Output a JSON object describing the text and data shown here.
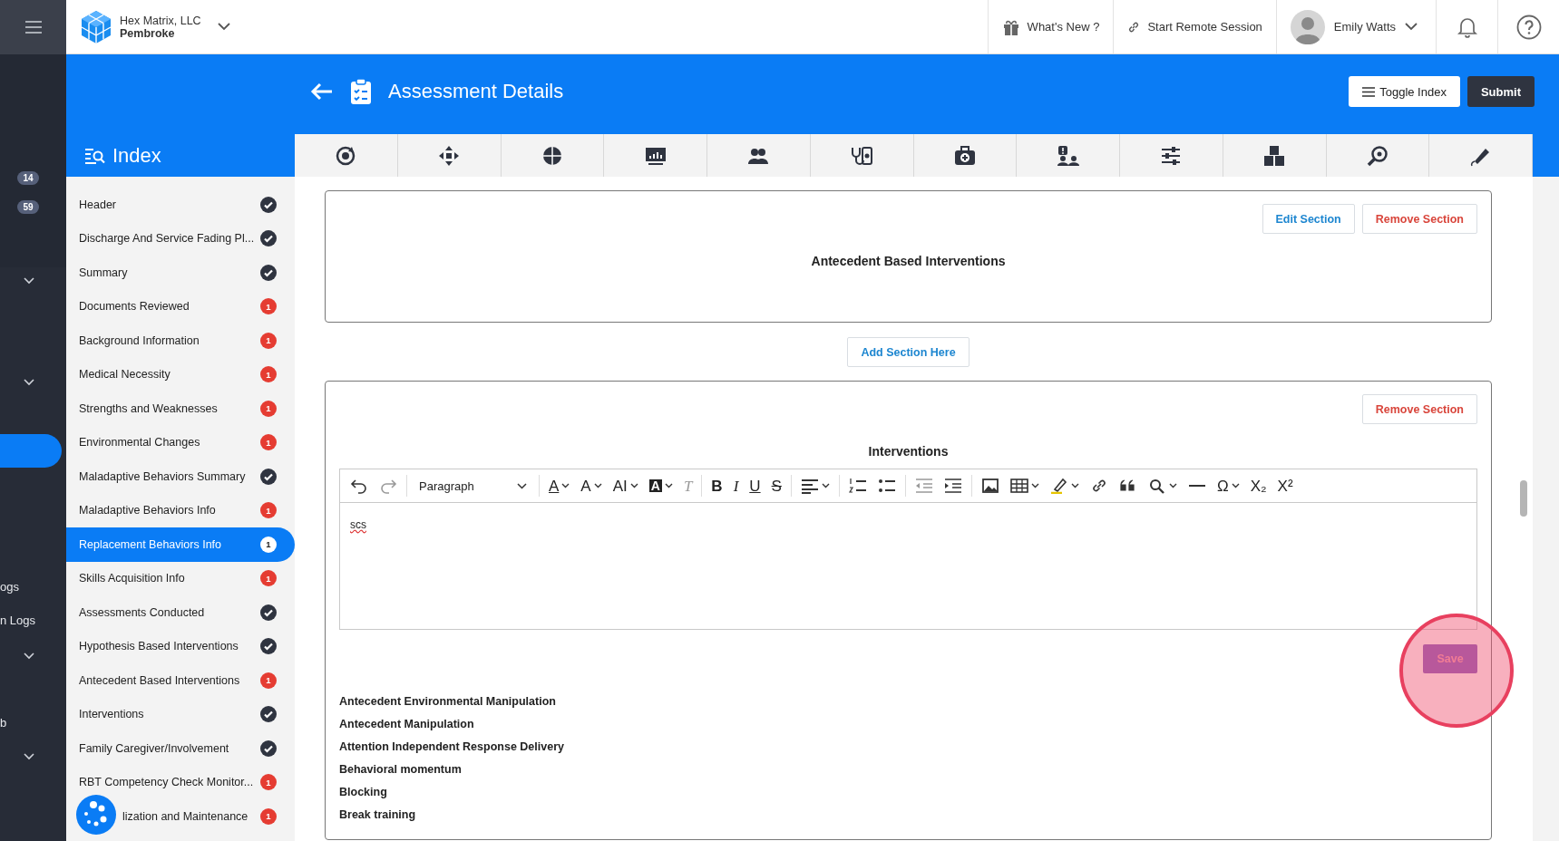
{
  "topbar": {
    "company": "Hex Matrix, LLC",
    "location": "Pembroke",
    "whats_new": "What's New ?",
    "remote_session": "Start Remote Session",
    "user": "Emily Watts"
  },
  "rail": {
    "badges": [
      "14",
      "59"
    ],
    "partial_items": [
      {
        "text": "ogs"
      },
      {
        "text": "n Logs"
      },
      {
        "text": "b"
      }
    ]
  },
  "header": {
    "title": "Assessment Details",
    "toggle_index": "Toggle Index",
    "submit": "Submit"
  },
  "index": {
    "title": "Index",
    "items": [
      {
        "label": "Header",
        "complete": true,
        "selected": false
      },
      {
        "label": "Discharge And Service Fading Pl...",
        "complete": true,
        "selected": false
      },
      {
        "label": "Summary",
        "complete": true,
        "selected": false
      },
      {
        "label": "Documents Reviewed",
        "complete": false,
        "count": "1",
        "selected": false
      },
      {
        "label": "Background Information",
        "complete": false,
        "count": "1",
        "selected": false
      },
      {
        "label": "Medical Necessity",
        "complete": false,
        "count": "1",
        "selected": false
      },
      {
        "label": "Strengths and Weaknesses",
        "complete": false,
        "count": "1",
        "selected": false
      },
      {
        "label": "Environmental Changes",
        "complete": false,
        "count": "1",
        "selected": false
      },
      {
        "label": "Maladaptive Behaviors Summary",
        "complete": true,
        "selected": false
      },
      {
        "label": "Maladaptive Behaviors Info",
        "complete": false,
        "count": "1",
        "selected": false
      },
      {
        "label": "Replacement Behaviors Info",
        "complete": false,
        "count": "1",
        "selected": true
      },
      {
        "label": "Skills Acquisition Info",
        "complete": false,
        "count": "1",
        "selected": false
      },
      {
        "label": "Assessments Conducted",
        "complete": true,
        "selected": false
      },
      {
        "label": "Hypothesis Based Interventions",
        "complete": true,
        "selected": false
      },
      {
        "label": "Antecedent Based Interventions",
        "complete": false,
        "count": "1",
        "selected": false
      },
      {
        "label": "Interventions",
        "complete": true,
        "selected": false
      },
      {
        "label": "Family Caregiver/Involvement",
        "complete": true,
        "selected": false
      },
      {
        "label": "RBT Competency Check Monitor...",
        "complete": false,
        "count": "1",
        "selected": false
      },
      {
        "label": "lization and Maintenance",
        "complete": false,
        "count": "1",
        "selected": false
      }
    ]
  },
  "sections": [
    {
      "title": "Antecedent Based Interventions",
      "edit": "Edit Section",
      "remove": "Remove Section"
    },
    {
      "title": "Interventions",
      "remove": "Remove Section"
    }
  ],
  "add_section": "Add Section Here",
  "editor": {
    "toolbar": [
      {
        "kind": "undo"
      },
      {
        "kind": "redo"
      },
      {
        "kind": "separator"
      },
      {
        "kind": "format",
        "label": "Paragraph"
      },
      {
        "kind": "separator"
      },
      {
        "kind": "fontcolor",
        "label": "A",
        "dropdown": true
      },
      {
        "kind": "fontsize",
        "label": "A",
        "dropdown": true
      },
      {
        "kind": "lineheight",
        "label": "AI",
        "dropdown": true
      },
      {
        "kind": "inverse",
        "label": "A",
        "dropdown": true
      },
      {
        "kind": "clear",
        "label": "T"
      },
      {
        "kind": "separator"
      },
      {
        "kind": "bold",
        "label": "B"
      },
      {
        "kind": "italic",
        "label": "I"
      },
      {
        "kind": "underline",
        "label": "U"
      },
      {
        "kind": "strike",
        "label": "S"
      },
      {
        "kind": "separator"
      },
      {
        "kind": "align",
        "dropdown": true
      },
      {
        "kind": "separator"
      },
      {
        "kind": "numbered"
      },
      {
        "kind": "bulleted"
      },
      {
        "kind": "separator"
      },
      {
        "kind": "outdent"
      },
      {
        "kind": "indent"
      },
      {
        "kind": "separator"
      },
      {
        "kind": "image"
      },
      {
        "kind": "table",
        "dropdown": true
      },
      {
        "kind": "highlight",
        "dropdown": true
      },
      {
        "kind": "link"
      },
      {
        "kind": "quote"
      },
      {
        "kind": "find",
        "dropdown": true
      },
      {
        "kind": "rule"
      },
      {
        "kind": "plain",
        "label": "Ω",
        "dropdown": true
      },
      {
        "kind": "plain",
        "label": "X₂"
      },
      {
        "kind": "plain",
        "label": "X²"
      }
    ],
    "value": "scs",
    "save": "Save"
  },
  "options": [
    "Antecedent Environmental Manipulation",
    "Antecedent Manipulation",
    "Attention Independent Response Delivery",
    "Behavioral momentum",
    "Blocking",
    "Break training"
  ]
}
